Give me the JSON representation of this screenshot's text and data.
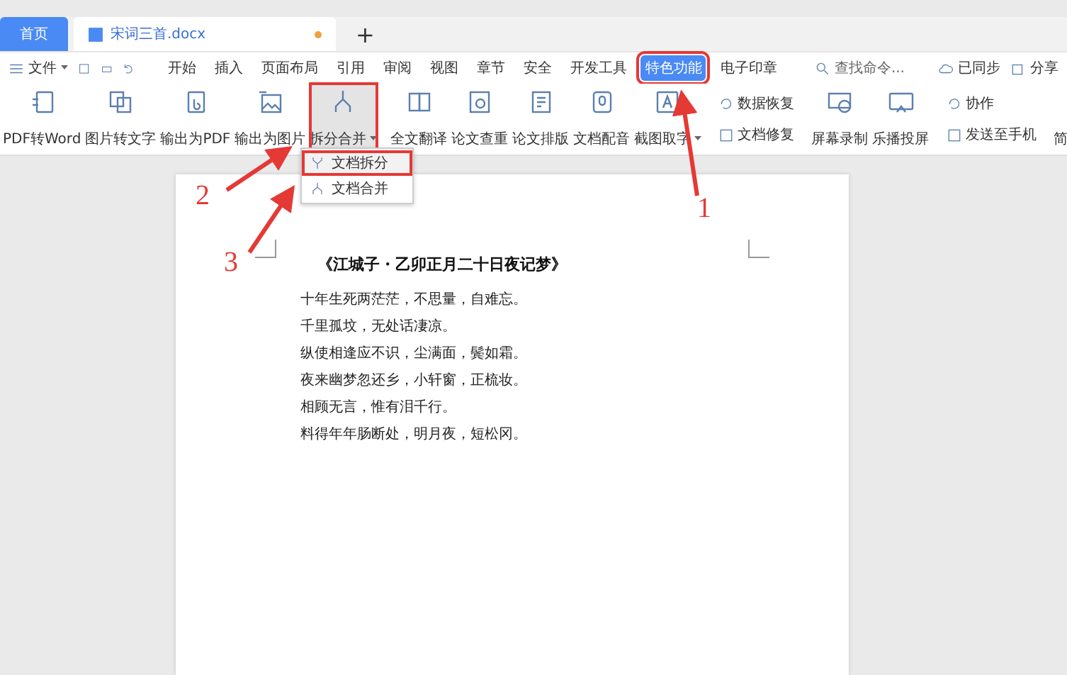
{
  "tabs": [
    {
      "label": "首页",
      "kind": "home",
      "selected": false
    },
    {
      "label": "宋词三首.docx",
      "kind": "doc",
      "selected": true,
      "modified": true
    }
  ],
  "new_tab": "+",
  "menu": {
    "file": "文件",
    "items": [
      {
        "label": "开始",
        "selected": false
      },
      {
        "label": "插入",
        "selected": false
      },
      {
        "label": "页面布局",
        "selected": false
      },
      {
        "label": "引用",
        "selected": false
      },
      {
        "label": "审阅",
        "selected": false
      },
      {
        "label": "视图",
        "selected": false
      },
      {
        "label": "章节",
        "selected": false
      },
      {
        "label": "安全",
        "selected": false
      },
      {
        "label": "开发工具",
        "selected": false
      },
      {
        "label": "特色功能",
        "selected": true,
        "highlighted": true
      },
      {
        "label": "电子印章",
        "selected": false
      }
    ]
  },
  "search": {
    "placeholder": "查找命令..."
  },
  "sync": "已同步",
  "share": "分享",
  "ribbon": [
    {
      "kind": "large",
      "label": "PDF转Word",
      "dropdown": false,
      "highlighted": false
    },
    {
      "kind": "large",
      "label": "图片转文字",
      "dropdown": false,
      "highlighted": false
    },
    {
      "kind": "large",
      "label": "输出为PDF",
      "dropdown": false,
      "highlighted": false
    },
    {
      "kind": "large",
      "label": "输出为图片",
      "dropdown": false,
      "highlighted": false
    },
    {
      "kind": "large",
      "label": "拆分合并",
      "dropdown": true,
      "highlighted": true
    },
    {
      "kind": "large",
      "label": "全文翻译",
      "dropdown": false,
      "highlighted": false
    },
    {
      "kind": "large",
      "label": "论文查重",
      "dropdown": false,
      "highlighted": false
    },
    {
      "kind": "large",
      "label": "论文排版",
      "dropdown": false,
      "highlighted": false
    },
    {
      "kind": "large",
      "label": "文档配音",
      "dropdown": false,
      "highlighted": false
    },
    {
      "kind": "large",
      "label": "截图取字",
      "dropdown": true,
      "highlighted": false
    },
    {
      "kind": "stack",
      "items": [
        "数据恢复",
        "文档修复"
      ]
    },
    {
      "kind": "large",
      "label": "屏幕录制",
      "dropdown": false,
      "highlighted": false
    },
    {
      "kind": "large",
      "label": "乐播投屏",
      "dropdown": false,
      "highlighted": false
    },
    {
      "kind": "stack",
      "items": [
        "协作",
        "发送至手机"
      ]
    },
    {
      "kind": "cut",
      "label": "简"
    }
  ],
  "dropdown_menu": [
    {
      "label": "文档拆分",
      "selected": true
    },
    {
      "label": "文档合并",
      "selected": false
    }
  ],
  "document": {
    "title": "《江城子・乙卯正月二十日夜记梦》",
    "lines": [
      "十年生死两茫茫，不思量，自难忘。",
      "千里孤坟，无处话凄凉。",
      "纵使相逢应不识，尘满面，鬓如霜。",
      "夜来幽梦忽还乡，小轩窗，正梳妆。",
      "相顾无言，惟有泪千行。",
      "料得年年肠断处，明月夜，短松冈。"
    ]
  },
  "annotations": [
    {
      "label": "1"
    },
    {
      "label": "2"
    },
    {
      "label": "3"
    }
  ]
}
